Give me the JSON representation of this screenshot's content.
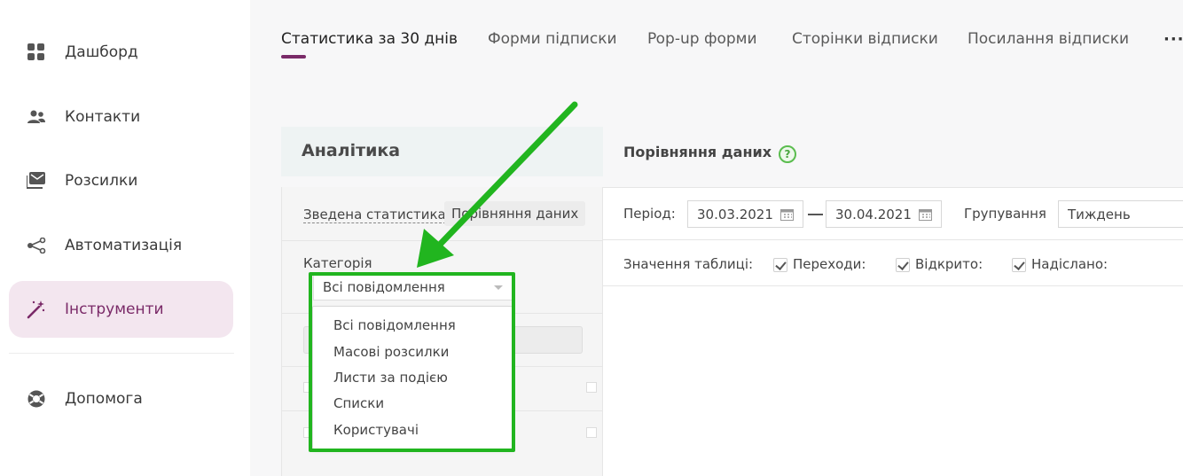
{
  "sidebar": {
    "items": [
      {
        "label": "Дашборд",
        "icon": "dashboard-grid-icon"
      },
      {
        "label": "Контакти",
        "icon": "contacts-icon"
      },
      {
        "label": "Розсилки",
        "icon": "mailing-icon"
      },
      {
        "label": "Автоматизація",
        "icon": "automation-icon"
      },
      {
        "label": "Інструменти",
        "icon": "magic-wand-icon",
        "active": true
      },
      {
        "label": "Допомога",
        "icon": "help-lifebuoy-icon"
      }
    ]
  },
  "tabs": [
    {
      "label": "Статистика за 30 днів",
      "active": true
    },
    {
      "label": "Форми підписки"
    },
    {
      "label": "Pop-up форми"
    },
    {
      "label": "Сторінки відписки"
    },
    {
      "label": "Посилання відписки"
    }
  ],
  "more_label": "···",
  "analytics": {
    "title": "Аналітика",
    "subtab_summary": "Зведена статистика",
    "subtab_compare": "Порівняння даних",
    "category_label": "Категорія",
    "category_selected": "Всі повідомлення",
    "category_options": [
      "Всі повідомлення",
      "Масові розсилки",
      "Листи за подією",
      "Списки",
      "Користувачі"
    ]
  },
  "comparison": {
    "title": "Порівняння даних",
    "help_glyph": "?",
    "period_label": "Період:",
    "date_from": "30.03.2021",
    "date_to": "30.04.2021",
    "grouping_label": "Групування",
    "grouping_value": "Тиждень",
    "table_values_label": "Значення таблиці:",
    "checkboxes": [
      {
        "label": "Переходи:",
        "checked": true
      },
      {
        "label": "Відкрито:",
        "checked": true
      },
      {
        "label": "Надіслано:",
        "checked": true
      }
    ]
  },
  "colors": {
    "accent": "#7a2a68",
    "active_bg": "#f3e6ef",
    "annotation_green": "#21b51f"
  }
}
